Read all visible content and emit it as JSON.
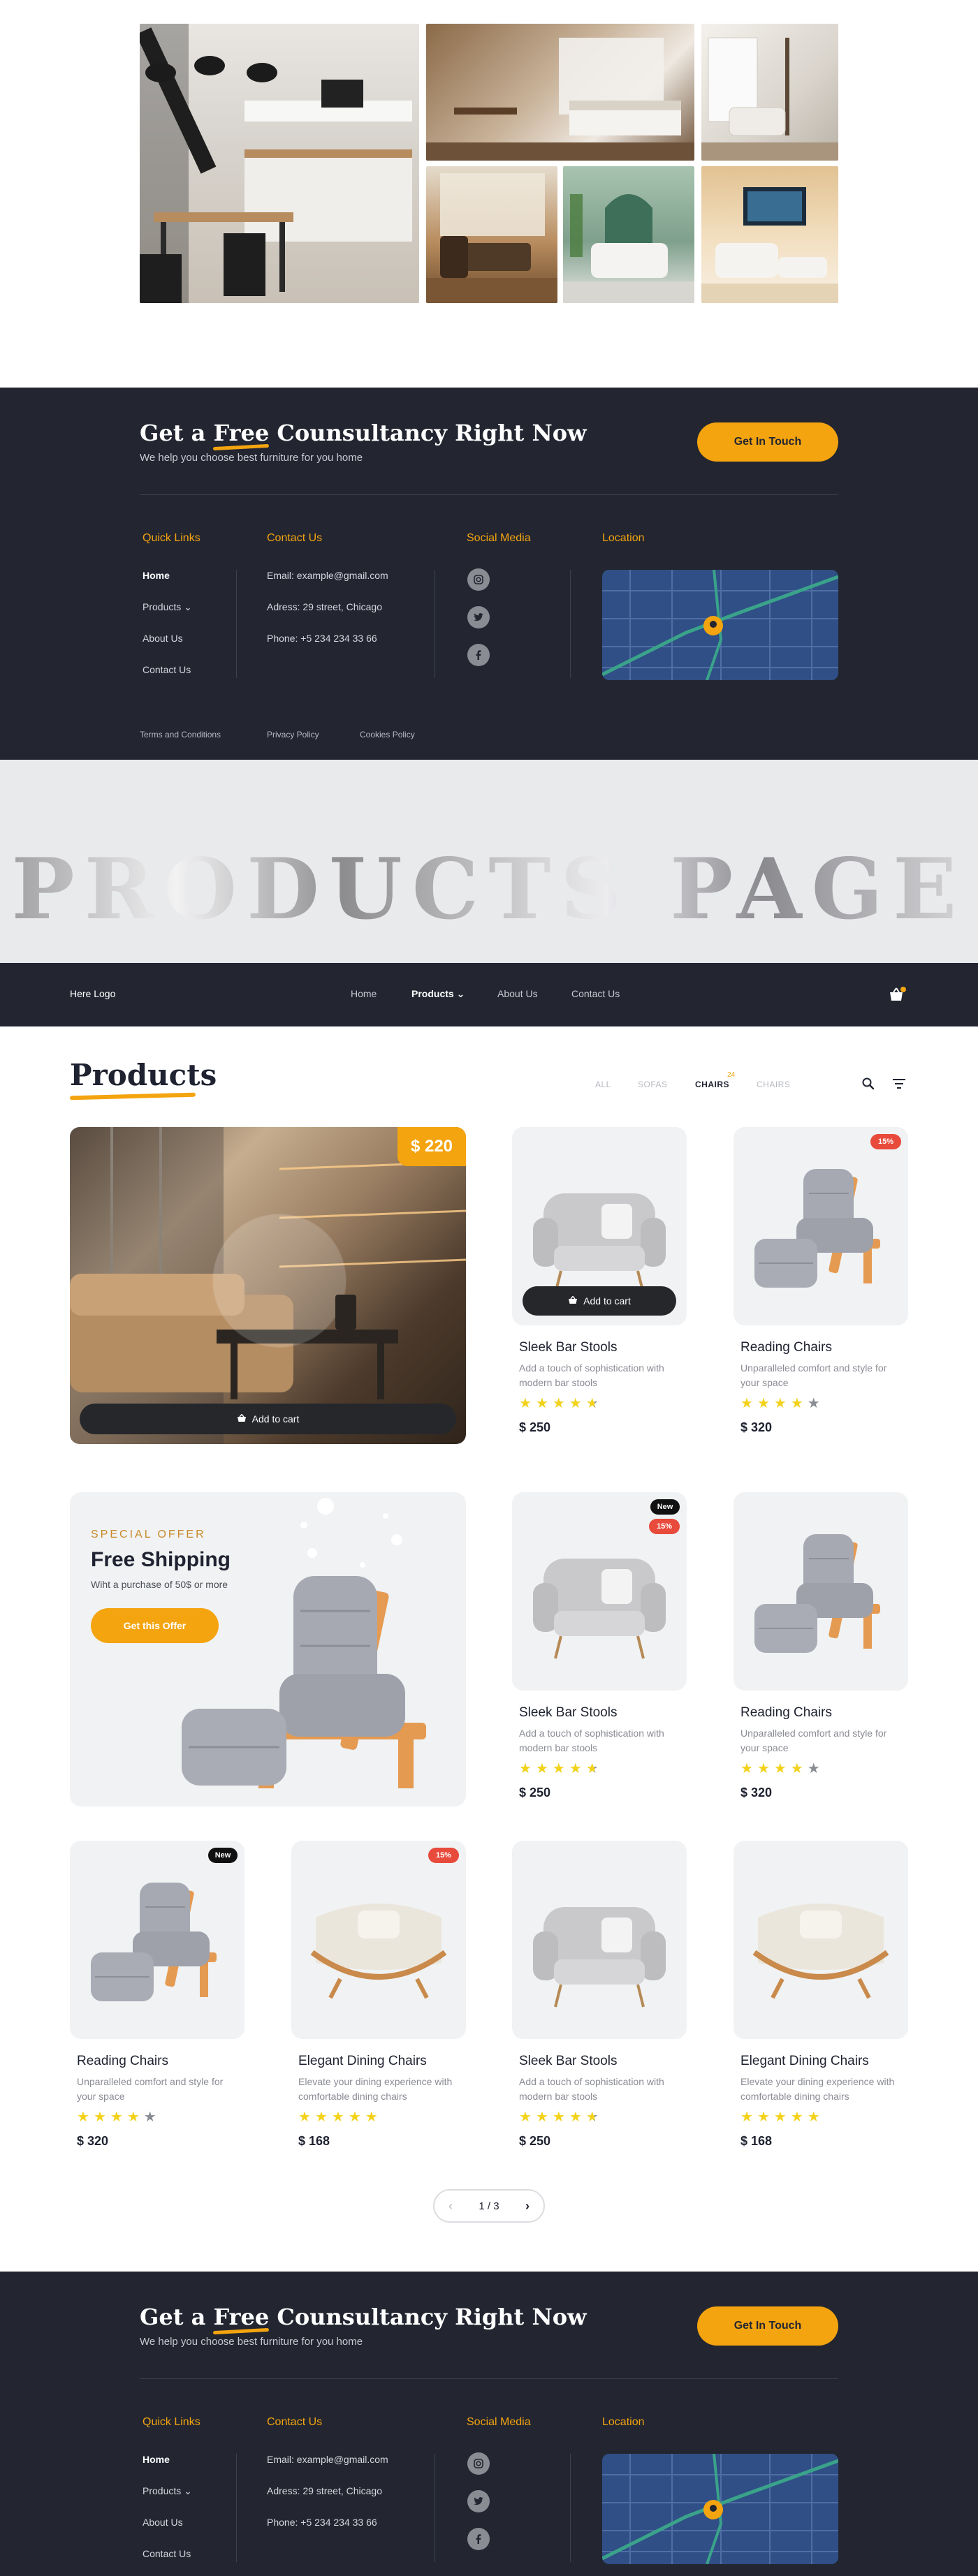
{
  "cta": {
    "title_before": "Get a ",
    "title_free": "Free",
    "title_after": " Counsultancy Right Now",
    "subtitle": "We help you choose best furniture for you home",
    "button": "Get In Touch"
  },
  "footer": {
    "quick_links_heading": "Quick Links",
    "quick_links": [
      "Home",
      "Products",
      "About Us",
      "Contact Us"
    ],
    "contact_heading": "Contact Us",
    "contact": {
      "email_label": "Email: ",
      "email": "example@gmail.com",
      "address_label": "Adress: ",
      "address": "29 street, Chicago",
      "phone_label": "Phone: ",
      "phone": "+5 234 234 33 66"
    },
    "social_heading": "Social Media",
    "social_icons": [
      "instagram-icon",
      "twitter-icon",
      "facebook-icon"
    ],
    "location_heading": "Location",
    "legal": [
      "Terms and Conditions",
      "Privacy Policy",
      "Cookies Policy"
    ]
  },
  "banner": {
    "text": "PRODUCTS PAGE"
  },
  "nav": {
    "logo": "Here Logo",
    "items": [
      "Home",
      "Products",
      "About Us",
      "Contact Us"
    ],
    "active": "Products"
  },
  "products": {
    "title": "Products",
    "filters": [
      "ALL",
      "SOFAS",
      "CHAIRS",
      "CHAIRS"
    ],
    "active_filter": "CHAIRS",
    "active_filter_count": "24",
    "hero": {
      "price": "$ 220",
      "cart_label": "Add to cart"
    },
    "offer": {
      "kicker": "SPECIAL OFFER",
      "heading": "Free Shipping",
      "subtext": "Wiht a purchase of 50$ or more",
      "button": "Get this Offer"
    },
    "cart_label": "Add to cart",
    "cards": [
      {
        "name": "Sleek Bar Stools",
        "desc": "Add a touch of sophistication with modern bar stools",
        "price": "$ 250",
        "rating": 4.5,
        "badges": [],
        "item": "gray-armchair"
      },
      {
        "name": "Reading Chairs",
        "desc": "Unparalleled comfort and style for your space",
        "price": "$ 320",
        "rating": 4,
        "badges": [
          "15%"
        ],
        "item": "wooden-recliner"
      },
      {
        "name": "Sleek Bar Stools",
        "desc": "Add a touch of sophistication with modern bar stools",
        "price": "$ 250",
        "rating": 4.5,
        "badges": [
          "New",
          "15%"
        ],
        "item": "gray-armchair"
      },
      {
        "name": "Reading Chairs",
        "desc": "Unparalleled comfort and style for your space",
        "price": "$ 320",
        "rating": 4,
        "badges": [],
        "item": "wooden-recliner"
      },
      {
        "name": "Reading Chairs",
        "desc": "Unparalleled comfort and style for your space",
        "price": "$ 320",
        "rating": 4,
        "badges": [
          "New"
        ],
        "item": "wooden-recliner"
      },
      {
        "name": "Elegant Dining Chairs",
        "desc": "Elevate your dining experience with comfortable dining chairs",
        "price": "$ 168",
        "rating": 5,
        "badges": [
          "15%"
        ],
        "item": "cream-lounge"
      },
      {
        "name": "Sleek Bar Stools",
        "desc": "Add a touch of sophistication with modern bar stools",
        "price": "$ 250",
        "rating": 4.5,
        "badges": [],
        "item": "gray-armchair"
      },
      {
        "name": "Elegant Dining Chairs",
        "desc": "Elevate your dining experience with comfortable dining chairs",
        "price": "$ 168",
        "rating": 5,
        "badges": [],
        "item": "cream-lounge"
      }
    ],
    "pagination": "1 / 3"
  },
  "colors": {
    "accent": "#f4a40f",
    "dark": "#232631",
    "sale_badge": "#e84a3b",
    "star": "#f2d21a"
  }
}
